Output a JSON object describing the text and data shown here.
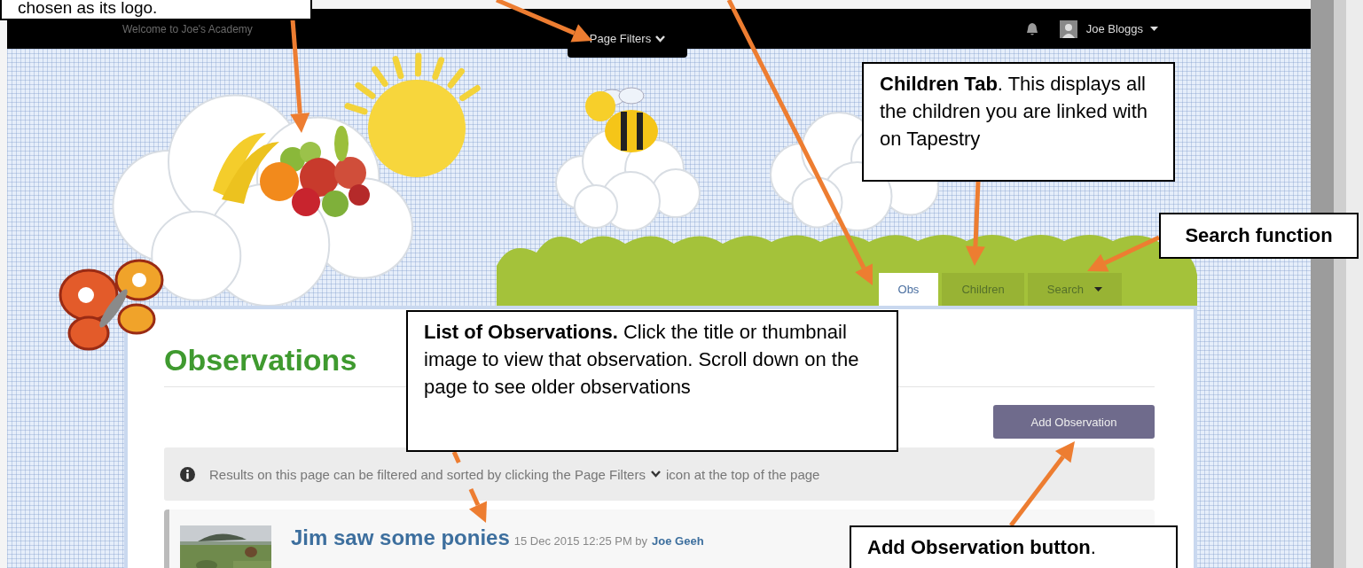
{
  "topbar": {
    "welcome": "Welcome to Joe's Academy",
    "page_filters": "Page Filters",
    "user": "Joe Bloggs"
  },
  "tabs": [
    {
      "label": "Obs",
      "selected": true,
      "has_menu": false
    },
    {
      "label": "Children",
      "selected": false,
      "has_menu": false
    },
    {
      "label": "Search",
      "selected": false,
      "has_menu": true
    }
  ],
  "page": {
    "heading": "Observations",
    "add_button": "Add Observation",
    "notice_before": "Results on this page can be filtered and sorted by clicking the Page Filters",
    "notice_after": "icon at the top of the page"
  },
  "observation": {
    "title": "Jim saw some ponies",
    "date": "15 Dec 2015 12:25 PM by",
    "author": "Joe Geeh"
  },
  "callouts": [
    {
      "text": "chosen as its logo.",
      "bold": false
    },
    {
      "text": "**Children Tab**. This displays all the children you are linked with on Tapestry",
      "bold": false
    },
    {
      "text": "Search function",
      "bold": true
    },
    {
      "text": "**List of Observations.** Click the title or thumbnail image to view that observation. Scroll down on the page to see older observations",
      "bold": false
    },
    {
      "text": "**Add Observation button**.",
      "bold": false
    }
  ]
}
